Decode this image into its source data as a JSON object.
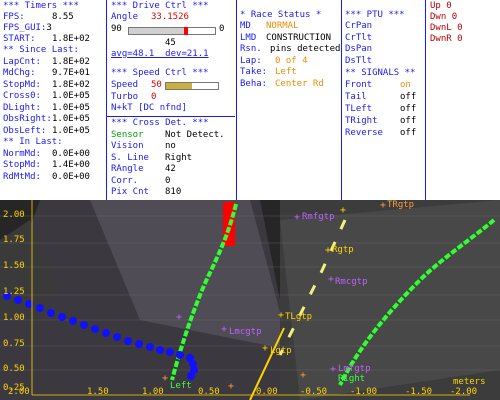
{
  "timers": {
    "header": "*** Timers ***",
    "fps": {
      "label": "FPS:",
      "value": "8.55"
    },
    "fps_gui": {
      "label": "FPS_GUI:",
      "value": "3"
    },
    "start": {
      "label": "START:",
      "value": "1.8E+02"
    },
    "since_header": "** Since Last:",
    "lapcnt": {
      "label": "LapCnt:",
      "value": "1.8E+02"
    },
    "mdchg": {
      "label": "MdChg:",
      "value": "9.7E+01"
    },
    "stopmd": {
      "label": "StopMd:",
      "value": "1.8E+02"
    },
    "cross0": {
      "label": "Cross0:",
      "value": "1.0E+05"
    },
    "dlight": {
      "label": "DLight:",
      "value": "1.0E+05"
    },
    "obsright": {
      "label": "ObsRight:",
      "value": "1.0E+05"
    },
    "obsleft": {
      "label": "ObsLeft:",
      "value": "1.0E+05"
    },
    "inlast_header": "** In Last:",
    "normmd": {
      "label": "NormMd:",
      "value": "0.0E+00"
    },
    "stopmd2": {
      "label": "StopMd:",
      "value": "1.4E+00"
    },
    "rdmtmd": {
      "label": "RdMtMd:",
      "value": "0.0E+00"
    }
  },
  "drive": {
    "header": "*** Drive Ctrl ***",
    "angle_label": "Angle",
    "angle_value": "33.1526",
    "slider_left": "90",
    "slider_right": "0",
    "slider_fraction": 0.66,
    "mid_value": "45",
    "avg_line": "avg=48.1  dev=21.1",
    "speed_header": "*** Speed Ctrl ***",
    "speed_label": "Speed",
    "speed_value": "50",
    "speed_fraction": 0.5,
    "turbo_label": "Turbo",
    "turbo_value": "0",
    "nkt_line": "N+kT [DC nfnd]",
    "cross_header": "*** Cross Det. ***",
    "sensor": {
      "label": "Sensor",
      "value": "Not Detect."
    },
    "vision": {
      "label": "Vision",
      "value": "no"
    },
    "sline": {
      "label": "S. Line",
      "value": "Right"
    },
    "rangle": {
      "label": "RAngle",
      "value": "42"
    },
    "corr": {
      "label": "Corr.",
      "value": "0"
    },
    "pixcnt": {
      "label": "Pix Cnt",
      "value": "810"
    }
  },
  "race": {
    "header": "* Race Status *",
    "md": {
      "label": "MD",
      "value": "NORMAL"
    },
    "lmd": {
      "label": "LMD",
      "value": "CONSTRUCTION"
    },
    "rsn": {
      "label": "Rsn.",
      "value": "pins detected"
    },
    "lap": {
      "label": "Lap:",
      "value": "0 of 4"
    },
    "take": {
      "label": "Take:",
      "value": "Left"
    },
    "beha": {
      "label": "Beha:",
      "value": "Center Rd"
    }
  },
  "ptu": {
    "header": "*** PTU ***",
    "items": [
      "CrPan",
      "CrTlt",
      "DsPan",
      "DsTlt"
    ],
    "signals_header": "** SIGNALS **",
    "signals": [
      {
        "label": "Front",
        "value": "on"
      },
      {
        "label": "Tail",
        "value": "off"
      },
      {
        "label": "TLeft",
        "value": "off"
      },
      {
        "label": "TRight",
        "value": "off"
      },
      {
        "label": "Reverse",
        "value": "off"
      }
    ]
  },
  "corner": {
    "items": [
      {
        "label": "Up",
        "value": "0"
      },
      {
        "label": "Dwn",
        "value": "0"
      },
      {
        "label": "DwnL",
        "value": "0"
      },
      {
        "label": "DwnR",
        "value": "0"
      }
    ]
  },
  "camera": {
    "y_ticks": [
      "2.00",
      "1.75",
      "1.50",
      "1.25",
      "1.00",
      "0.75",
      "0.50",
      "0.25"
    ],
    "x_ticks": [
      "2.00",
      "1.50",
      "1.00",
      "0.50",
      "0.00",
      "-0.50",
      "-1.00",
      "-1.50",
      "-2.00"
    ],
    "units": "meters",
    "markers": [
      {
        "label": "TRgtp",
        "color": "#ff9a3a"
      },
      {
        "label": "Rmfgtp",
        "color": "#c060ff"
      },
      {
        "label": "Rgtp",
        "color": "#ffd400"
      },
      {
        "label": "Rmcgtp",
        "color": "#c060ff"
      },
      {
        "label": "TLgtp",
        "color": "#ffd400"
      },
      {
        "label": "Lmcgtp",
        "color": "#c060ff"
      },
      {
        "label": "Lgtp",
        "color": "#ffd400"
      },
      {
        "label": "Lmfgtp",
        "color": "#c060ff"
      },
      {
        "label": "Right",
        "color": "#40ff40"
      },
      {
        "label": "Left",
        "color": "#40ff40"
      }
    ]
  },
  "colors": {
    "label_blue": "#1a1aff",
    "value_red": "#e00000",
    "value_orange": "#f08c00",
    "value_green": "#00a000",
    "axis_yellow": "#ffd400",
    "lane_green": "#30ff30",
    "path_blue": "#1010ff",
    "obstacle_red": "#ff0000"
  }
}
